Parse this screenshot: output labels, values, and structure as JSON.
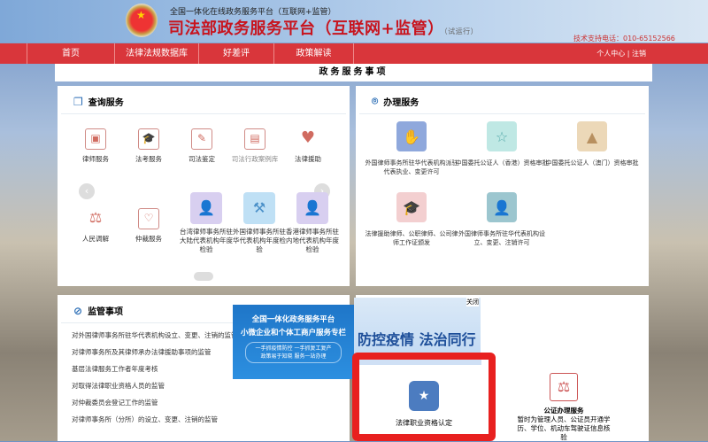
{
  "header": {
    "subtitle": "全国一体化在线政务服务平台（互联网+监管）",
    "title": "司法部政务服务平台（互联网+监管）",
    "trial": "（试运行）",
    "phone": "技术支持电话：010-65152566"
  },
  "nav": {
    "items": [
      "首页",
      "法律法规数据库",
      "好差评",
      "政策解读"
    ],
    "user_center": "个人中心",
    "logout": "注销",
    "sep": "|"
  },
  "section_title": "政务服务事项",
  "query": {
    "title": "查询服务",
    "items": [
      {
        "label": "律师服务",
        "icon": "id-card-icon"
      },
      {
        "label": "法考服务",
        "icon": "graduation-cap-icon"
      },
      {
        "label": "司法鉴定",
        "icon": "document-stamp-icon"
      },
      {
        "label": "司法行政案例库",
        "icon": "case-card-icon"
      },
      {
        "label": "法律援助",
        "icon": "handshake-heart-icon"
      },
      {
        "label": "人民调解",
        "icon": "gavel-icon"
      },
      {
        "label": "仲裁服务",
        "icon": "clipboard-heart-icon"
      },
      {
        "label": "台湾律师事务所驻大陆代表机构年度检验",
        "icon": "person-check-icon"
      },
      {
        "label": "外国律师事务所驻华代表机构年度检验",
        "icon": "gavel-check-icon"
      },
      {
        "label": "香港律师事务所驻内地代表机构年度检验",
        "icon": "person-check-icon"
      }
    ]
  },
  "handle": {
    "title": "办理服务",
    "items": [
      {
        "label": "外国律师事务所驻华代表机构派驻代表执业、变更许可",
        "color": "#8fa8dc"
      },
      {
        "label": "中国委托公证人（香港）资格审批",
        "color": "#bfe8e4"
      },
      {
        "label": "中国委托公证人（澳门）资格审批",
        "color": "#ecd8b8"
      },
      {
        "label": "法律援助律师、公职律师、公司律师工作证颁发",
        "color": "#f3cfd0"
      },
      {
        "label": "外国律师事务所驻华代表机构设立、变更、注销许可",
        "color": "#9cc6cf"
      }
    ]
  },
  "supervise": {
    "title": "监管事项",
    "items": [
      "对外国律师事务所驻华代表机构设立、变更、注销的监管",
      "对律师事务所及其律师承办法律援助事项的监管",
      "基层法律服务工作者年度考核",
      "对取得法律职业资格人员的监管",
      "对仲裁委员会登记工作的监管",
      "对律师事务所（分所）的设立、变更、注销的监管"
    ]
  },
  "ads": {
    "ad1_line1": "全国一体化政务服务平台",
    "ad1_line2": "小微企业和个体工商户服务专栏",
    "ad1_line3": "一手抓疫情防控 一手抓复工复产",
    "ad1_line4": "政策易于知晓 服务一站办理",
    "ad2_close": "关闭",
    "ad2_text": "防控疫情 法治同行"
  },
  "featured": {
    "label": "法律职业资格认定",
    "notary_label": "公证办理服务",
    "notary_desc": "暂时为管理人员、公证员开通学历、学位、机动车驾驶证信息核验"
  }
}
